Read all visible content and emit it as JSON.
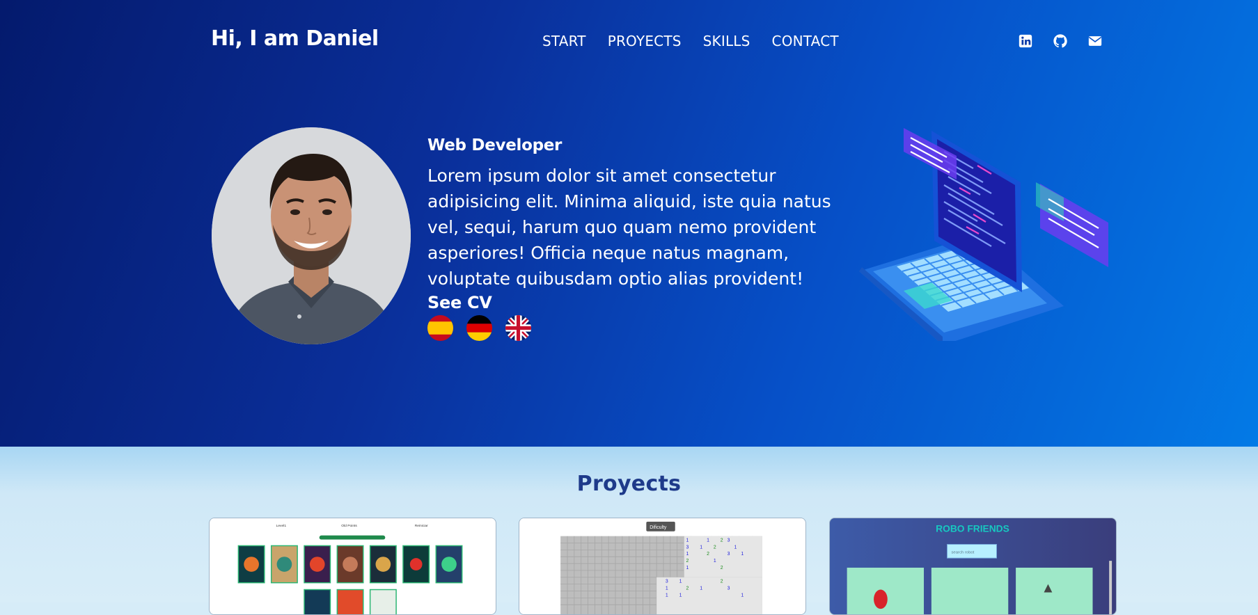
{
  "header": {
    "brand": "Hi, I am Daniel",
    "menu": [
      "START",
      "PROYECTS",
      "SKILLS",
      "CONTACT"
    ],
    "social_icons": [
      "linkedin-icon",
      "github-icon",
      "envelope-icon"
    ]
  },
  "hero": {
    "role": "Web Developer",
    "bio": "Lorem ipsum dolor sit amet consectetur adipisicing elit. Minima aliquid, iste quia natus vel, sequi, harum quo quam nemo provident asperiores! Officia neque natus magnam, voluptate quibusdam optio alias provident!",
    "cv_label": "See CV",
    "cv_flags": [
      "spain-flag-icon",
      "germany-flag-icon",
      "uk-flag-icon"
    ]
  },
  "projects": {
    "title": "Proyects",
    "cards": [
      {
        "name": "memory-game-preview",
        "labels": [
          "Level1",
          "Old Points",
          "Reiniciar"
        ]
      },
      {
        "name": "minesweeper-preview",
        "labels": [
          "Dificulty"
        ]
      },
      {
        "name": "robofriends-preview",
        "labels": [
          "ROBO FRIENDS",
          "search robot"
        ]
      }
    ]
  },
  "colors": {
    "hero_gradient_start": "#041a6d",
    "hero_gradient_end": "#037ae6",
    "projects_bg": "#d6ecf8",
    "projects_title": "#1e3a8a"
  }
}
